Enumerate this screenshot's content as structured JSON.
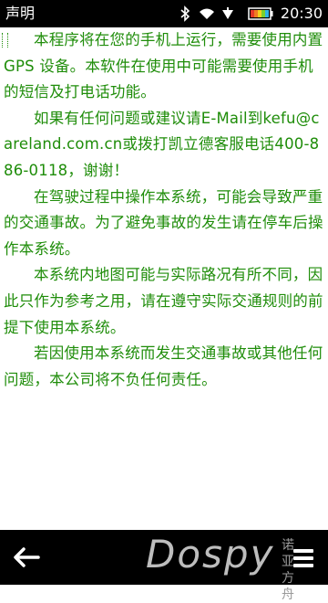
{
  "statusbar": {
    "title": "声明",
    "time": "20:30",
    "icons": [
      "bluetooth-icon",
      "wifi-icon",
      "signal-icon",
      "battery-icon"
    ]
  },
  "content": {
    "text_color": "#1f8d0a",
    "paragraphs": [
      "本程序将在您的手机上运行，需要使用内置 GPS 设备。本软件在使用中可能需要使用手机的短信及打电话功能。",
      "如果有任何问题或建议请E-Mail到kefu@careland.com.cn或拨打凯立德客服电话400-886-0118，谢谢！",
      "在驾驶过程中操作本系统，可能会导致严重的交通事故。为了避免事故的发生请在停车后操作本系统。",
      "本系统内地图可能与实际路况有所不同，因此只作为参考之用，请在遵守实际交通规则的前提下使用本系统。",
      "若因使用本系统而发生交通事故或其他任何问题，本公司将不负任何责任。"
    ]
  },
  "bottombar": {
    "back_icon": "back-arrow-icon",
    "menu_icon": "menu-icon",
    "watermark": "Dospy",
    "watermark_sub": "诺亚方舟"
  }
}
